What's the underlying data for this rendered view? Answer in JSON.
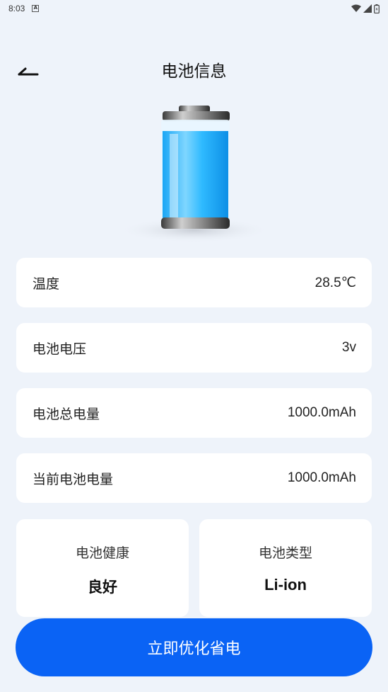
{
  "status_bar": {
    "time": "8:03",
    "notification_icon": "a-box-icon",
    "icons": [
      "wifi-icon",
      "signal-icon",
      "battery-status-icon"
    ]
  },
  "header": {
    "title": "电池信息",
    "back_icon": "back-arrow-icon"
  },
  "battery_image": {
    "icon": "battery-illustration",
    "fill_color": "#2bb7ff"
  },
  "info_rows": [
    {
      "label": "温度",
      "value": "28.5℃"
    },
    {
      "label": "电池电压",
      "value": "3v"
    },
    {
      "label": "电池总电量",
      "value": "1000.0mAh"
    },
    {
      "label": "当前电池电量",
      "value": "1000.0mAh"
    }
  ],
  "stats": {
    "health": {
      "label": "电池健康",
      "value": "良好"
    },
    "type": {
      "label": "电池类型",
      "value": "Li-ion"
    }
  },
  "action_button": {
    "label": "立即优化省电",
    "color": "#0a63f5"
  }
}
